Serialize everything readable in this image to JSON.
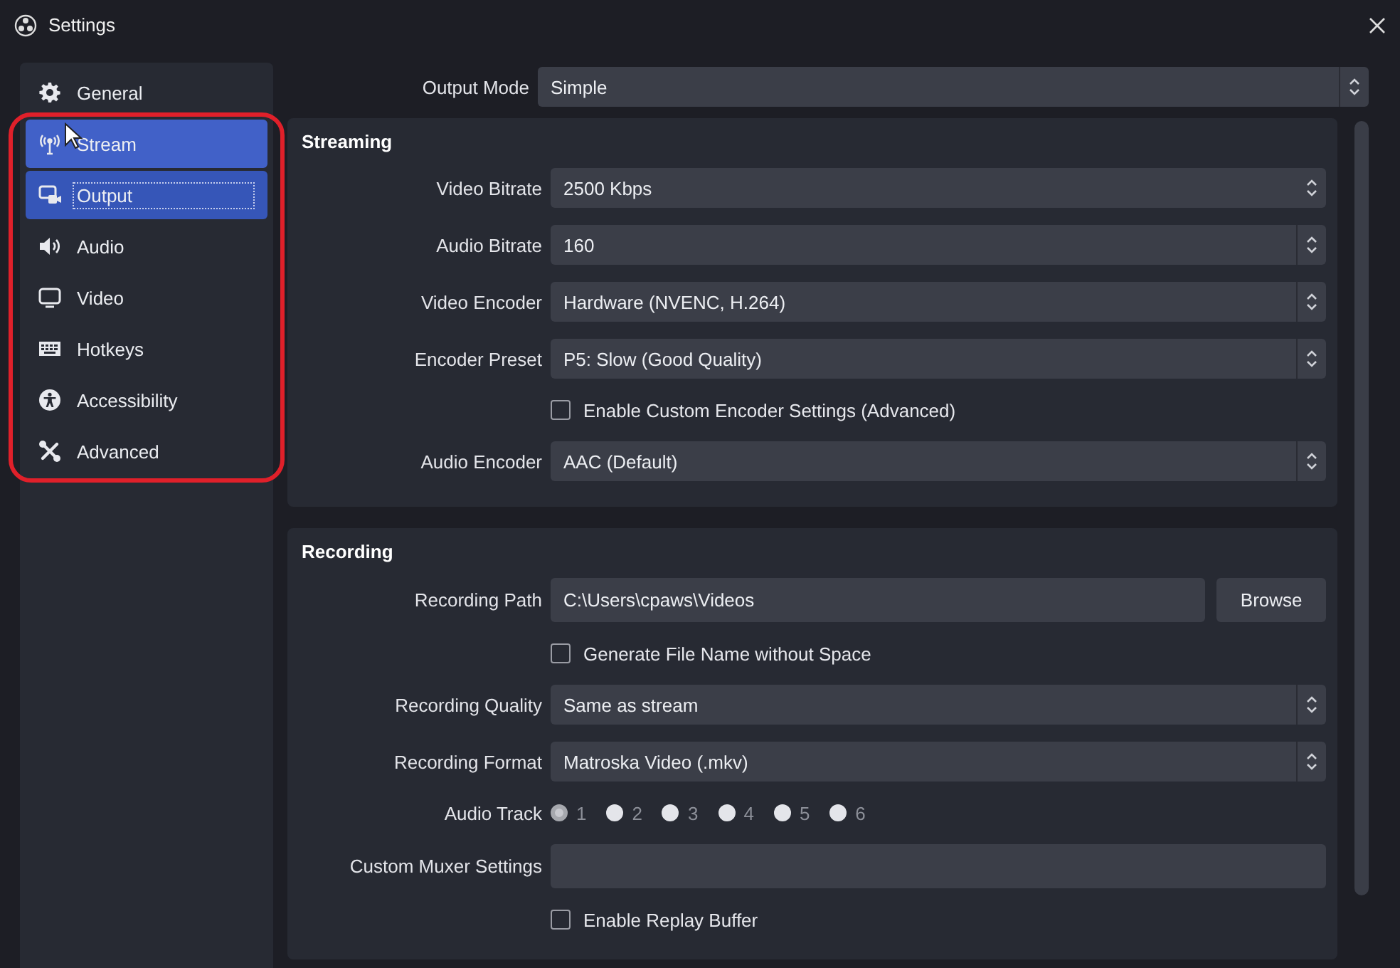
{
  "window": {
    "title": "Settings"
  },
  "sidebar": {
    "items": [
      {
        "label": "General",
        "selected": false,
        "hovered": false
      },
      {
        "label": "Stream",
        "selected": false,
        "hovered": true
      },
      {
        "label": "Output",
        "selected": true,
        "hovered": false
      },
      {
        "label": "Audio",
        "selected": false,
        "hovered": false
      },
      {
        "label": "Video",
        "selected": false,
        "hovered": false
      },
      {
        "label": "Hotkeys",
        "selected": false,
        "hovered": false
      },
      {
        "label": "Accessibility",
        "selected": false,
        "hovered": false
      },
      {
        "label": "Advanced",
        "selected": false,
        "hovered": false
      }
    ]
  },
  "output_mode": {
    "label": "Output Mode",
    "value": "Simple"
  },
  "groups": [
    {
      "title": "Streaming",
      "rows": [
        {
          "kind": "spin",
          "label": "Video Bitrate",
          "value": "2500 Kbps"
        },
        {
          "kind": "combo",
          "label": "Audio Bitrate",
          "value": "160"
        },
        {
          "kind": "combo",
          "label": "Video Encoder",
          "value": "Hardware (NVENC, H.264)"
        },
        {
          "kind": "combo",
          "label": "Encoder Preset",
          "value": "P5: Slow (Good Quality)"
        },
        {
          "kind": "check",
          "label": "Enable Custom Encoder Settings (Advanced)",
          "checked": false
        },
        {
          "kind": "combo",
          "label": "Audio Encoder",
          "value": "AAC (Default)"
        }
      ]
    },
    {
      "title": "Recording",
      "rows": [
        {
          "kind": "path",
          "label": "Recording Path",
          "value": "C:\\Users\\cpaws\\Videos",
          "button": "Browse"
        },
        {
          "kind": "check",
          "label": "Generate File Name without Space",
          "checked": false
        },
        {
          "kind": "combo",
          "label": "Recording Quality",
          "value": "Same as stream"
        },
        {
          "kind": "combo",
          "label": "Recording Format",
          "value": "Matroska Video (.mkv)"
        },
        {
          "kind": "radio",
          "label": "Audio Track",
          "options": [
            {
              "label": "1",
              "selected": true
            },
            {
              "label": "2",
              "selected": false
            },
            {
              "label": "3",
              "selected": false
            },
            {
              "label": "4",
              "selected": false
            },
            {
              "label": "5",
              "selected": false
            },
            {
              "label": "6",
              "selected": false
            }
          ]
        },
        {
          "kind": "text",
          "label": "Custom Muxer Settings"
        },
        {
          "kind": "check",
          "label": "Enable Replay Buffer",
          "checked": false
        }
      ]
    }
  ]
}
